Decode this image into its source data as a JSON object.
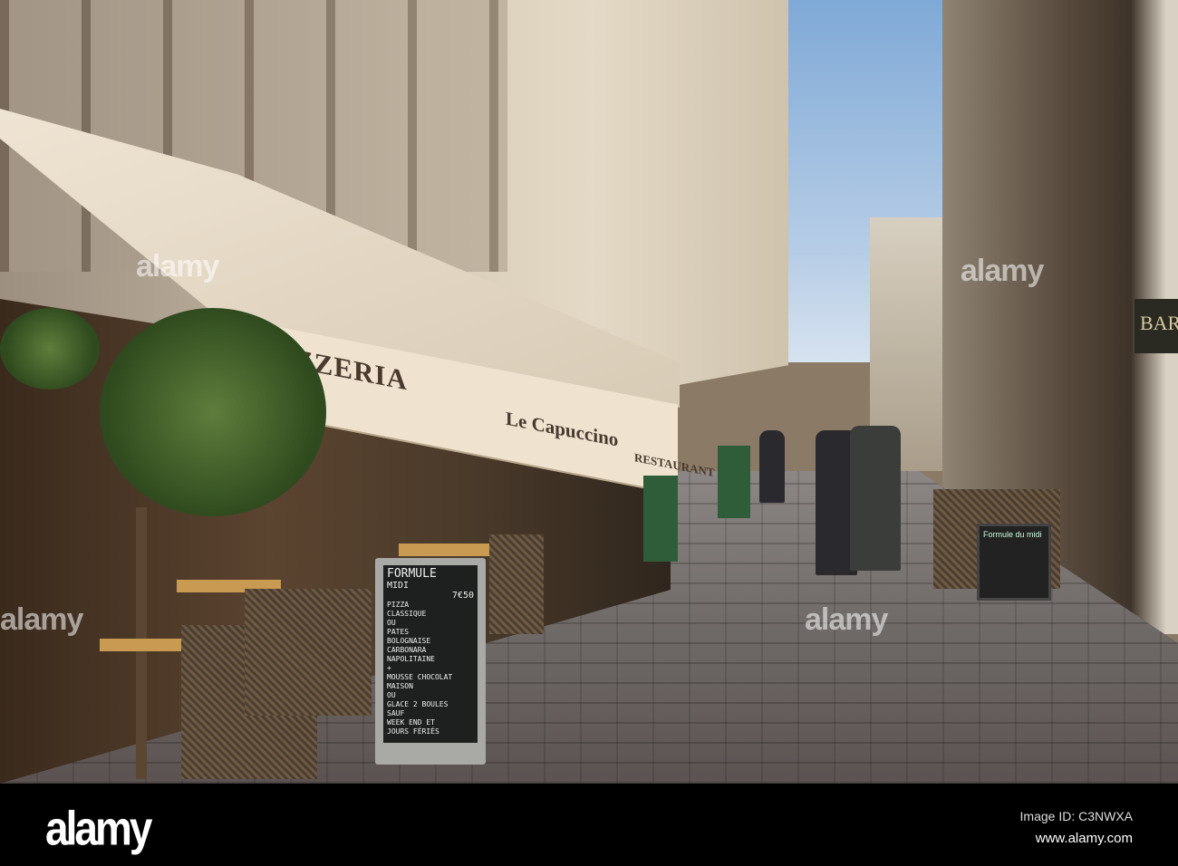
{
  "awning": {
    "shop_name": "PIZZERIA",
    "brand": "Le Capuccino",
    "sub": "RESTAURANT"
  },
  "menu_board": {
    "title": "FORMULE",
    "subtitle": "MIDI",
    "price": "7€50",
    "lines": [
      "PIZZA",
      "CLASSIQUE",
      "OU",
      "PATES",
      "BOLOGNAISE",
      "CARBONARA",
      "NAPOLITAINE",
      "+",
      "MOUSSE CHOCOLAT",
      "MAISON",
      "OU",
      "GLACE 2 BOULES",
      "SAUF",
      "WEEK END ET",
      "JOURS FÉRIÉS"
    ]
  },
  "right_board": {
    "text": "Formule du midi"
  },
  "bar_sign": "BAR",
  "watermark": "alamy",
  "footer": {
    "logo": "alamy",
    "image_id": "Image ID: C3NWXA",
    "url": "www.alamy.com"
  }
}
